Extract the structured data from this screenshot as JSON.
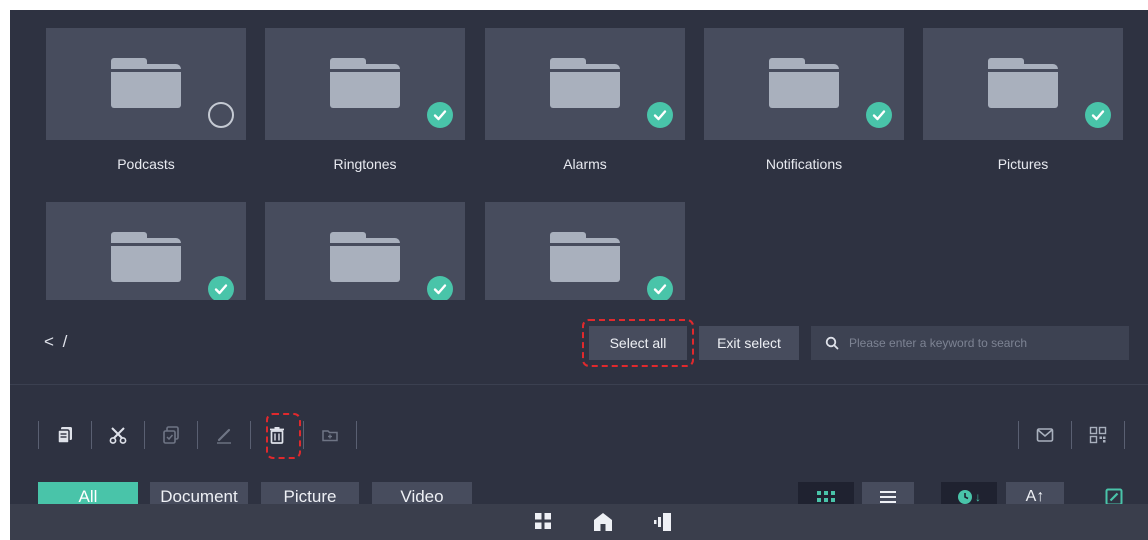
{
  "folders": [
    {
      "name": "Podcasts",
      "selected": false
    },
    {
      "name": "Ringtones",
      "selected": true
    },
    {
      "name": "Alarms",
      "selected": true
    },
    {
      "name": "Notifications",
      "selected": true
    },
    {
      "name": "Pictures",
      "selected": true
    },
    {
      "name": "",
      "selected": true
    },
    {
      "name": "",
      "selected": true
    },
    {
      "name": "",
      "selected": true
    }
  ],
  "path": {
    "back_symbol": "<",
    "current": "/"
  },
  "actions": {
    "select_all": "Select all",
    "exit_select": "Exit select"
  },
  "search": {
    "placeholder": "Please enter a keyword to search",
    "icon": "search-icon"
  },
  "toolbar": {
    "left_tools": [
      "copy-icon",
      "cut-icon",
      "paste-icon",
      "rename-icon",
      "delete-icon",
      "new-folder-icon"
    ],
    "right_tools": [
      "email-icon",
      "qr-code-icon"
    ]
  },
  "filters": {
    "tabs": [
      "All",
      "Document",
      "Picture",
      "Video"
    ],
    "active": "All"
  },
  "view": {
    "sort_name_label": "A↑",
    "sort_time_label": "↓"
  },
  "nav": {
    "icons": [
      "apps-icon",
      "home-icon",
      "exit-icon"
    ]
  },
  "colors": {
    "accent": "#49c4a9",
    "background": "#2e3241",
    "tile": "#474c5d",
    "highlight": "#e0292d"
  }
}
